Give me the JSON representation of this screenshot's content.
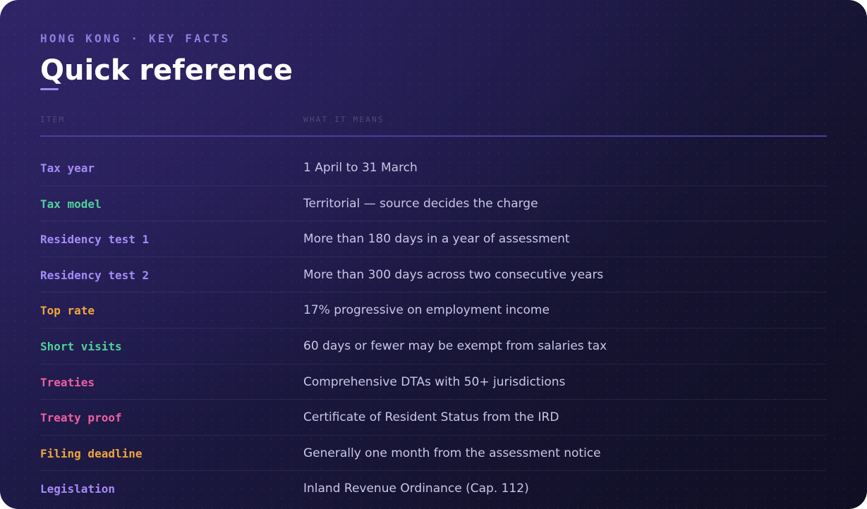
{
  "header": {
    "eyebrow": "HONG KONG · KEY FACTS",
    "title": "Quick reference"
  },
  "table": {
    "columns": [
      "ITEM",
      "WHAT IT MEANS"
    ],
    "rows": [
      {
        "item": "Tax year",
        "meaning": "1 April to 31 March",
        "accent": "purple"
      },
      {
        "item": "Tax model",
        "meaning": "Territorial — source decides the charge",
        "accent": "green"
      },
      {
        "item": "Residency test 1",
        "meaning": "More than 180 days in a year of assessment",
        "accent": "purple"
      },
      {
        "item": "Residency test 2",
        "meaning": "More than 300 days across two consecutive years",
        "accent": "purple"
      },
      {
        "item": "Top rate",
        "meaning": "17% progressive on employment income",
        "accent": "amber"
      },
      {
        "item": "Short visits",
        "meaning": "60 days or fewer may be exempt from salaries tax",
        "accent": "green"
      },
      {
        "item": "Treaties",
        "meaning": "Comprehensive DTAs with 50+ jurisdictions",
        "accent": "pink"
      },
      {
        "item": "Treaty proof",
        "meaning": "Certificate of Resident Status from the IRD",
        "accent": "pink"
      },
      {
        "item": "Filing deadline",
        "meaning": "Generally one month from the assessment notice",
        "accent": "amber"
      },
      {
        "item": "Legislation",
        "meaning": "Inland Revenue Ordinance (Cap. 112)",
        "accent": "purple"
      }
    ]
  },
  "colors": {
    "purple": "#a58bf7",
    "green": "#4fd19a",
    "amber": "#f0a53c",
    "pink": "#ee5fa0",
    "eyebrow": "#8b7fe0",
    "background": "#1e1a48"
  }
}
